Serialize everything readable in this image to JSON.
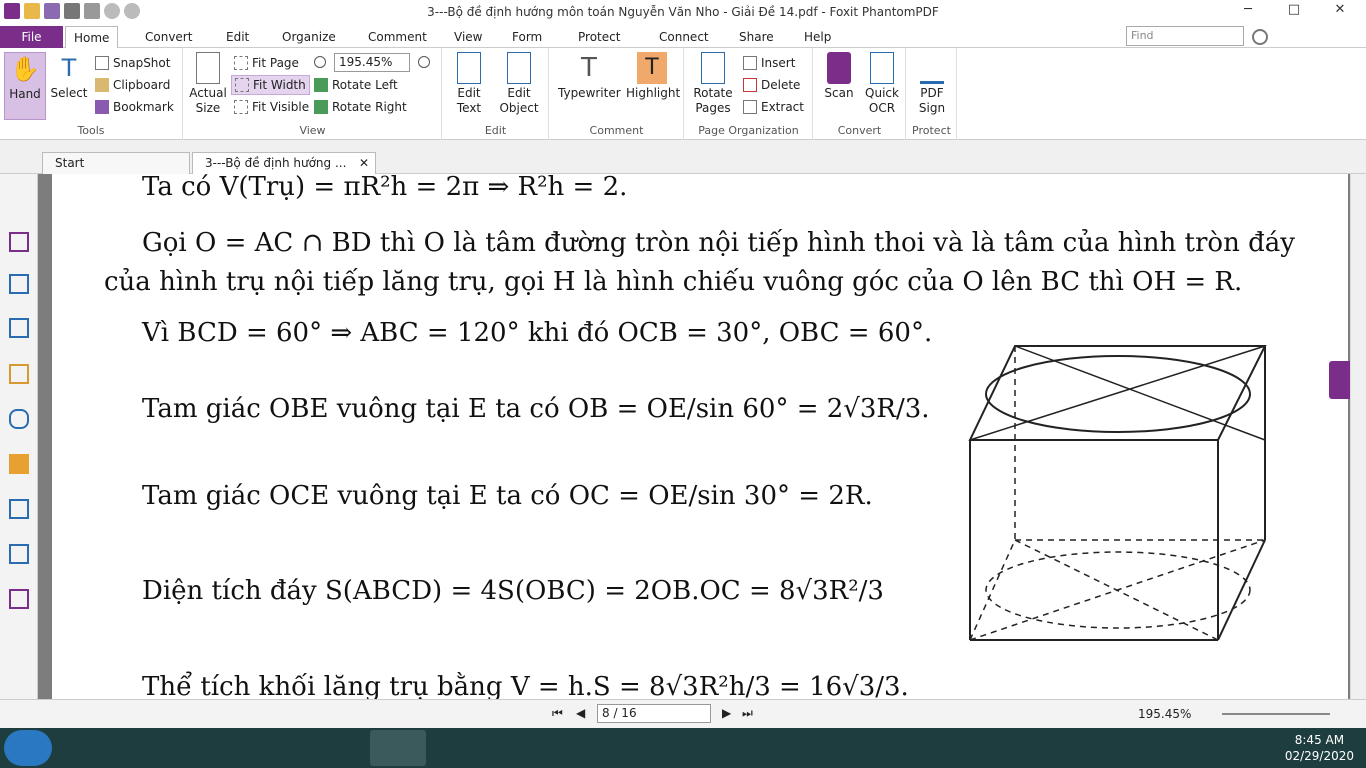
{
  "window": {
    "title": "3---Bộ đề định hướng môn toán Nguyễn Văn Nho - Giải Đề 14.pdf - Foxit PhantomPDF"
  },
  "menu": {
    "file": "File",
    "tabs": [
      "Home",
      "Convert",
      "Edit",
      "Organize",
      "Comment",
      "View",
      "Form",
      "Protect",
      "Connect",
      "Share",
      "Help"
    ],
    "find_placeholder": "Find"
  },
  "ribbon": {
    "tools": {
      "hand": "Hand",
      "select": "Select",
      "snapshot": "SnapShot",
      "clipboard": "Clipboard",
      "bookmark": "Bookmark",
      "label": "Tools"
    },
    "view": {
      "actual_size_1": "Actual",
      "actual_size_2": "Size",
      "fit_page": "Fit Page",
      "fit_width": "Fit Width",
      "fit_visible": "Fit Visible",
      "zoom": "195.45%",
      "rotate_left": "Rotate Left",
      "rotate_right": "Rotate Right",
      "label": "View"
    },
    "edit": {
      "edit_text_1": "Edit",
      "edit_text_2": "Text",
      "edit_object_1": "Edit",
      "edit_object_2": "Object",
      "label": "Edit"
    },
    "comment": {
      "typewriter": "Typewriter",
      "highlight": "Highlight",
      "label": "Comment"
    },
    "page_org": {
      "rotate_pages_1": "Rotate",
      "rotate_pages_2": "Pages",
      "insert": "Insert",
      "delete": "Delete",
      "extract": "Extract",
      "label": "Page Organization"
    },
    "convert": {
      "scan": "Scan",
      "quick_ocr_1": "Quick",
      "quick_ocr_2": "OCR",
      "label": "Convert"
    },
    "protect": {
      "pdf_sign_1": "PDF",
      "pdf_sign_2": "Sign",
      "label": "Protect"
    }
  },
  "tabs": {
    "start": "Start",
    "doc": "3---Bộ đề định hướng ..."
  },
  "document": {
    "lines": [
      "Ta có  V(Trụ) = πR²h = 2π ⇒ R²h = 2.",
      "Gọi  O = AC ∩ BD  thì  O  là tâm đường tròn nội tiếp hình thoi và là tâm của hình tròn đáy",
      "của hình trụ nội tiếp lăng trụ, gọi  H  là hình chiếu vuông góc của  O  lên  BC  thì  OH = R.",
      "Vì  BCD = 60° ⇒ ABC = 120°  khi đó  OCB = 30°, OBC = 60°.",
      "Tam giác  OBE  vuông tại  E  ta có  OB = OE/sin 60° = 2√3R/3.",
      "Tam giác  OCE  vuông tại  E  ta có  OC = OE/sin 30° = 2R.",
      "Diện tích đáy  S(ABCD) = 4S(OBC) = 2OB.OC = 8√3R²/3",
      "Thể tích khối lăng trụ bằng  V = h.S = 8√3R²h/3 = 16√3/3."
    ]
  },
  "status": {
    "page": "8 / 16",
    "zoom": "195.45%"
  },
  "taskbar": {
    "time": "8:45 AM",
    "date": "02/29/2020"
  }
}
